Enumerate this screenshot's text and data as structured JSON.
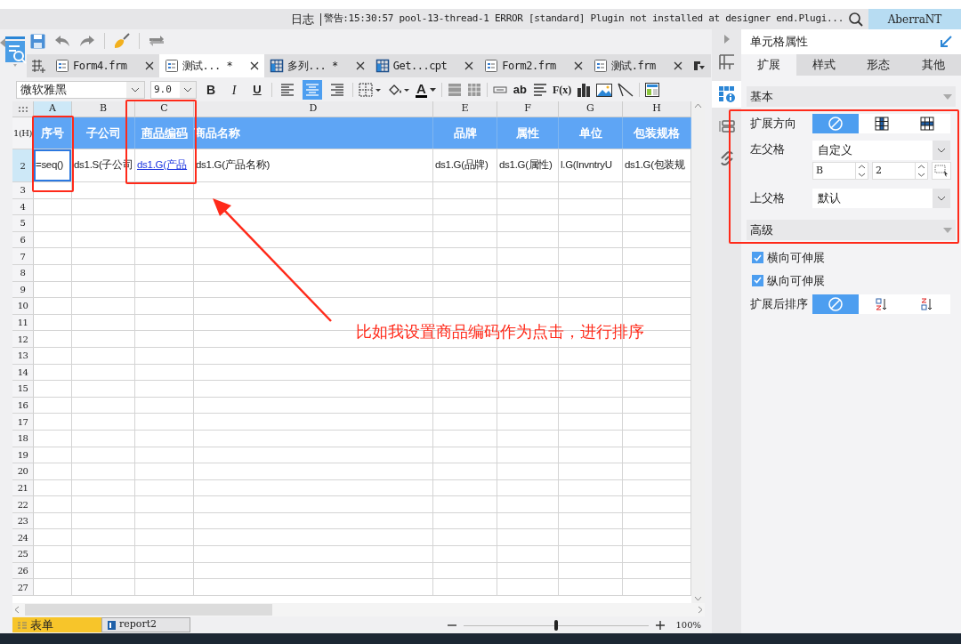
{
  "log_bar": {
    "label": "日志",
    "message": "警告:15:30:57 pool-13-thread-1 ERROR [standard] Plugin not installed at designer end.Plugi...",
    "user": "AberraNT"
  },
  "file_tabs": [
    {
      "label": "Form4.frm",
      "kind": "form",
      "selected": false
    },
    {
      "label": "测试... *",
      "kind": "form",
      "selected": true
    },
    {
      "label": "多列... *",
      "kind": "report",
      "selected": false
    },
    {
      "label": "Get...cpt",
      "kind": "report",
      "selected": false
    },
    {
      "label": "Form2.frm",
      "kind": "form",
      "selected": false
    },
    {
      "label": "测试.frm",
      "kind": "form",
      "selected": false
    }
  ],
  "format_bar": {
    "font": "微软雅黑",
    "size": "9.0",
    "items": [
      {
        "kind": "bold",
        "label": "B"
      },
      {
        "kind": "italic",
        "label": "I"
      },
      {
        "kind": "underline",
        "label": "U"
      },
      {
        "kind": "align-left",
        "selected": false
      },
      {
        "kind": "align-center",
        "selected": true
      },
      {
        "kind": "align-right",
        "selected": false
      },
      {
        "kind": "border"
      },
      {
        "kind": "fill"
      },
      {
        "kind": "font-color",
        "label": "A"
      },
      {
        "kind": "merge"
      },
      {
        "kind": "unmerge"
      },
      {
        "kind": "field"
      },
      {
        "kind": "text",
        "label": "ab"
      },
      {
        "kind": "paragraph"
      },
      {
        "kind": "formula",
        "label": "F(x)"
      },
      {
        "kind": "chart"
      },
      {
        "kind": "image"
      },
      {
        "kind": "slash"
      },
      {
        "kind": "subreport"
      }
    ]
  },
  "sheet": {
    "columns": [
      {
        "label": "A",
        "selected": true
      },
      {
        "label": "B",
        "selected": false
      },
      {
        "label": "C",
        "selected": false
      },
      {
        "label": "D",
        "selected": false
      },
      {
        "label": "E",
        "selected": false
      },
      {
        "label": "F",
        "selected": false
      },
      {
        "label": "G",
        "selected": false
      },
      {
        "label": "H",
        "selected": false
      }
    ],
    "rows": [
      {
        "label": "1(H)",
        "kind": "header",
        "selected": false,
        "cells": [
          {
            "text": "序号",
            "centered": true,
            "link": false,
            "selected": false
          },
          {
            "text": "子公司",
            "centered": true,
            "link": false,
            "selected": false
          },
          {
            "text": "商品编码",
            "centered": true,
            "link": true,
            "selected": false
          },
          {
            "text": "商品名称",
            "centered": false,
            "link": false,
            "selected": false
          },
          {
            "text": "品牌",
            "centered": true,
            "link": false,
            "selected": false
          },
          {
            "text": "属性",
            "centered": true,
            "link": false,
            "selected": false
          },
          {
            "text": "单位",
            "centered": true,
            "link": false,
            "selected": false
          },
          {
            "text": "包装规格",
            "centered": true,
            "link": false,
            "selected": false
          }
        ]
      },
      {
        "label": "2",
        "kind": "data",
        "selected": true,
        "cells": [
          {
            "text": "=seq()",
            "centered": false,
            "link": false,
            "selected": true
          },
          {
            "text": "ds1.S(子公司",
            "centered": false,
            "link": false,
            "selected": false
          },
          {
            "text": "ds1.G(产品",
            "centered": false,
            "link": true,
            "selected": false
          },
          {
            "text": "ds1.G(产品名称)",
            "centered": false,
            "link": false,
            "selected": false
          },
          {
            "text": "ds1.G(品牌)",
            "centered": false,
            "link": false,
            "selected": false
          },
          {
            "text": "ds1.G(属性)",
            "centered": false,
            "link": false,
            "selected": false
          },
          {
            "text": "l.G(InvntryU",
            "centered": false,
            "link": false,
            "selected": false
          },
          {
            "text": "ds1.G(包装规",
            "centered": false,
            "link": false,
            "selected": false
          }
        ]
      },
      {
        "label": "3",
        "kind": "empty",
        "selected": false
      },
      {
        "label": "4",
        "kind": "empty",
        "selected": false
      },
      {
        "label": "5",
        "kind": "empty",
        "selected": false
      },
      {
        "label": "6",
        "kind": "empty",
        "selected": false
      },
      {
        "label": "7",
        "kind": "empty",
        "selected": false
      },
      {
        "label": "8",
        "kind": "empty",
        "selected": false
      },
      {
        "label": "9",
        "kind": "empty",
        "selected": false
      },
      {
        "label": "10",
        "kind": "empty",
        "selected": false
      },
      {
        "label": "11",
        "kind": "empty",
        "selected": false
      },
      {
        "label": "12",
        "kind": "empty",
        "selected": false
      },
      {
        "label": "13",
        "kind": "empty",
        "selected": false
      },
      {
        "label": "14",
        "kind": "empty",
        "selected": false
      },
      {
        "label": "15",
        "kind": "empty",
        "selected": false
      },
      {
        "label": "16",
        "kind": "empty",
        "selected": false
      },
      {
        "label": "17",
        "kind": "empty",
        "selected": false
      },
      {
        "label": "18",
        "kind": "empty",
        "selected": false
      },
      {
        "label": "19",
        "kind": "empty",
        "selected": false
      },
      {
        "label": "20",
        "kind": "empty",
        "selected": false
      },
      {
        "label": "21",
        "kind": "empty",
        "selected": false
      },
      {
        "label": "22",
        "kind": "empty",
        "selected": false
      },
      {
        "label": "23",
        "kind": "empty",
        "selected": false
      },
      {
        "label": "24",
        "kind": "empty",
        "selected": false
      },
      {
        "label": "25",
        "kind": "empty",
        "selected": false
      },
      {
        "label": "26",
        "kind": "empty",
        "selected": false
      },
      {
        "label": "27",
        "kind": "empty",
        "selected": false
      }
    ]
  },
  "sheet_tabs": [
    {
      "label": "表单",
      "kind": "form",
      "selected": true
    },
    {
      "label": "report2",
      "kind": "report",
      "selected": false
    }
  ],
  "zoom": {
    "level": 0.5,
    "reading": "100%"
  },
  "side_tabs": [
    {
      "kind": "layout",
      "selected": false
    },
    {
      "kind": "info",
      "selected": true
    },
    {
      "kind": "list",
      "selected": false
    },
    {
      "kind": "link",
      "selected": false
    }
  ],
  "properties": {
    "title": "单元格属性",
    "tabs": [
      {
        "label": "扩展",
        "selected": true
      },
      {
        "label": "样式",
        "selected": false
      },
      {
        "label": "形态",
        "selected": false
      },
      {
        "label": "其他",
        "selected": false
      }
    ],
    "basic": {
      "title": "基本",
      "expand_direction": {
        "label": "扩展方向",
        "options": [
          {
            "kind": "none",
            "selected": true
          },
          {
            "kind": "vertical",
            "selected": false
          },
          {
            "kind": "horizontal",
            "selected": false
          }
        ]
      },
      "left_parent": {
        "label": "左父格",
        "value": "自定义",
        "column": "B",
        "row": "2"
      },
      "top_parent": {
        "label": "上父格",
        "value": "默认"
      }
    },
    "advanced": {
      "title": "高级",
      "options": [
        {
          "label": "横向可伸展",
          "checked": true
        },
        {
          "label": "纵向可伸展",
          "checked": true
        }
      ],
      "sort": {
        "label": "扩展后排序",
        "options": [
          {
            "kind": "none",
            "selected": true
          },
          {
            "kind": "ascending",
            "selected": false
          },
          {
            "kind": "descending",
            "selected": false
          }
        ]
      }
    }
  },
  "annotation": {
    "text": "比如我设置商品编码作为点击，进行排序"
  }
}
